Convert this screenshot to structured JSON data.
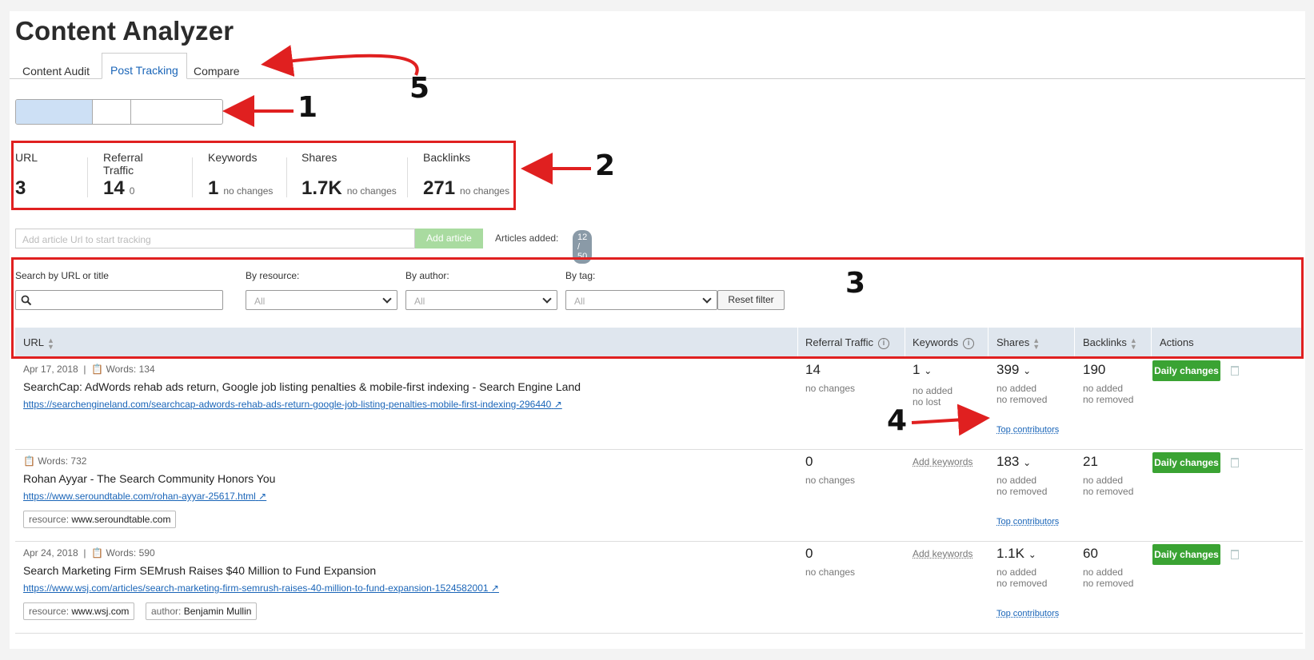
{
  "app": {
    "title": "Content Analyzer"
  },
  "tabs": [
    {
      "label": "Content Audit"
    },
    {
      "label": "Post Tracking"
    },
    {
      "label": "Compare"
    }
  ],
  "annotations": [
    "1",
    "2",
    "3",
    "4",
    "5"
  ],
  "summary": {
    "url": {
      "label": "URL",
      "value": "3"
    },
    "referral": {
      "label": "Referral Traffic",
      "value": "14",
      "sub": "0"
    },
    "keywords": {
      "label": "Keywords",
      "value": "1",
      "sub": "no changes"
    },
    "shares": {
      "label": "Shares",
      "value": "1.7K",
      "sub": "no changes"
    },
    "backlinks": {
      "label": "Backlinks",
      "value": "271",
      "sub": "no changes"
    }
  },
  "add_article": {
    "placeholder": "Add article Url to start tracking",
    "button": "Add article",
    "added_label": "Articles added:",
    "added_badge": "12 / 50"
  },
  "filters": {
    "search_label": "Search by URL or title",
    "resource_label": "By resource:",
    "author_label": "By author:",
    "tag_label": "By tag:",
    "resource_value": "All",
    "author_value": "All",
    "tag_value": "All",
    "reset": "Reset filter"
  },
  "table": {
    "headers": {
      "url": "URL",
      "referral": "Referral Traffic",
      "keywords": "Keywords",
      "shares": "Shares",
      "backlinks": "Backlinks",
      "actions": "Actions"
    },
    "rows": [
      {
        "date": "Apr 17, 2018",
        "words": "Words: 134",
        "title": "SearchCap: AdWords rehab ads return, Google job listing penalties & mobile-first indexing - Search Engine Land",
        "url": "https://searchengineland.com/searchcap-adwords-rehab-ads-return-google-job-listing-penalties-mobile-first-indexing-296440",
        "referral": "14",
        "referral_sub": "no changes",
        "keywords": "1",
        "keywords_sub1": "no added",
        "keywords_sub2": "no lost",
        "shares": "399",
        "shares_sub1": "no added",
        "shares_sub2": "no removed",
        "backlinks": "190",
        "backlinks_sub1": "no added",
        "backlinks_sub2": "no removed",
        "top_contributors": "Top contributors",
        "daily": "Daily changes"
      },
      {
        "words": "Words: 732",
        "title": "Rohan Ayyar - The Search Community Honors You",
        "url": "https://www.seroundtable.com/rohan-ayyar-25617.html",
        "resource_key": "resource:",
        "resource_val": "www.seroundtable.com",
        "referral": "0",
        "referral_sub": "no changes",
        "add_keywords": "Add keywords",
        "shares": "183",
        "shares_sub1": "no added",
        "shares_sub2": "no removed",
        "backlinks": "21",
        "backlinks_sub1": "no added",
        "backlinks_sub2": "no removed",
        "top_contributors": "Top contributors",
        "daily": "Daily changes"
      },
      {
        "date": "Apr 24, 2018",
        "words": "Words: 590",
        "title": "Search Marketing Firm SEMrush Raises $40 Million to Fund Expansion",
        "url": "https://www.wsj.com/articles/search-marketing-firm-semrush-raises-40-million-to-fund-expansion-1524582001",
        "resource_key": "resource:",
        "resource_val": "www.wsj.com",
        "author_key": "author:",
        "author_val": "Benjamin Mullin",
        "referral": "0",
        "referral_sub": "no changes",
        "add_keywords": "Add keywords",
        "shares": "1.1K",
        "shares_sub1": "no added",
        "shares_sub2": "no removed",
        "backlinks": "60",
        "backlinks_sub1": "no added",
        "backlinks_sub2": "no removed",
        "top_contributors": "Top contributors",
        "daily": "Daily changes"
      }
    ]
  },
  "colors": {
    "annotation": "#e02020",
    "link": "#1a65b8",
    "primary_button": "#3aa333"
  }
}
